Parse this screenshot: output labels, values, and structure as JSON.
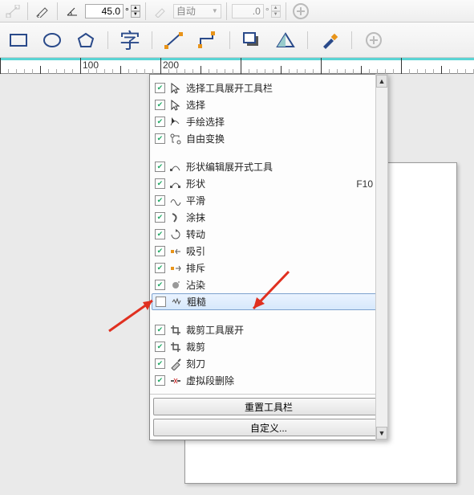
{
  "toolbar1": {
    "angle_value": "45.0",
    "angle_unit": "°",
    "auto_label": "自动",
    "second_angle": ".0",
    "second_unit": "°"
  },
  "ruler": {
    "ticks": [
      {
        "pos": 100,
        "label": "100"
      },
      {
        "pos": 200,
        "label": "200"
      }
    ]
  },
  "menu": {
    "groups": [
      {
        "items": [
          {
            "id": "select-expand",
            "label": "选择工具展开工具栏",
            "checked": true,
            "icon": "cursor"
          },
          {
            "id": "select",
            "label": "选择",
            "checked": true,
            "icon": "cursor"
          },
          {
            "id": "freehand-select",
            "label": "手绘选择",
            "checked": true,
            "icon": "freehand"
          },
          {
            "id": "free-transform",
            "label": "自由变换",
            "checked": true,
            "icon": "transform"
          }
        ]
      },
      {
        "items": [
          {
            "id": "shape-edit-expand",
            "label": "形状编辑展开式工具",
            "checked": true,
            "icon": "shape-edit"
          },
          {
            "id": "shape",
            "label": "形状",
            "checked": true,
            "icon": "shape",
            "shortcut": "F10"
          },
          {
            "id": "smooth",
            "label": "平滑",
            "checked": true,
            "icon": "smooth"
          },
          {
            "id": "smear",
            "label": "涂抹",
            "checked": true,
            "icon": "smear"
          },
          {
            "id": "rotate",
            "label": "转动",
            "checked": true,
            "icon": "rotate"
          },
          {
            "id": "attract",
            "label": "吸引",
            "checked": true,
            "icon": "attract"
          },
          {
            "id": "repel",
            "label": "排斥",
            "checked": true,
            "icon": "repel"
          },
          {
            "id": "stain",
            "label": "沾染",
            "checked": true,
            "icon": "stain"
          },
          {
            "id": "roughen",
            "label": "粗糙",
            "checked": false,
            "icon": "roughen",
            "highlighted": true
          }
        ]
      },
      {
        "items": [
          {
            "id": "crop-expand",
            "label": "裁剪工具展开",
            "checked": true,
            "icon": "crop"
          },
          {
            "id": "crop",
            "label": "裁剪",
            "checked": true,
            "icon": "crop"
          },
          {
            "id": "knife",
            "label": "刻刀",
            "checked": true,
            "icon": "knife"
          },
          {
            "id": "virtual-delete",
            "label": "虚拟段删除",
            "checked": true,
            "icon": "virtual-delete"
          }
        ]
      }
    ],
    "reset_button": "重置工具栏",
    "customize_button": "自定义..."
  }
}
